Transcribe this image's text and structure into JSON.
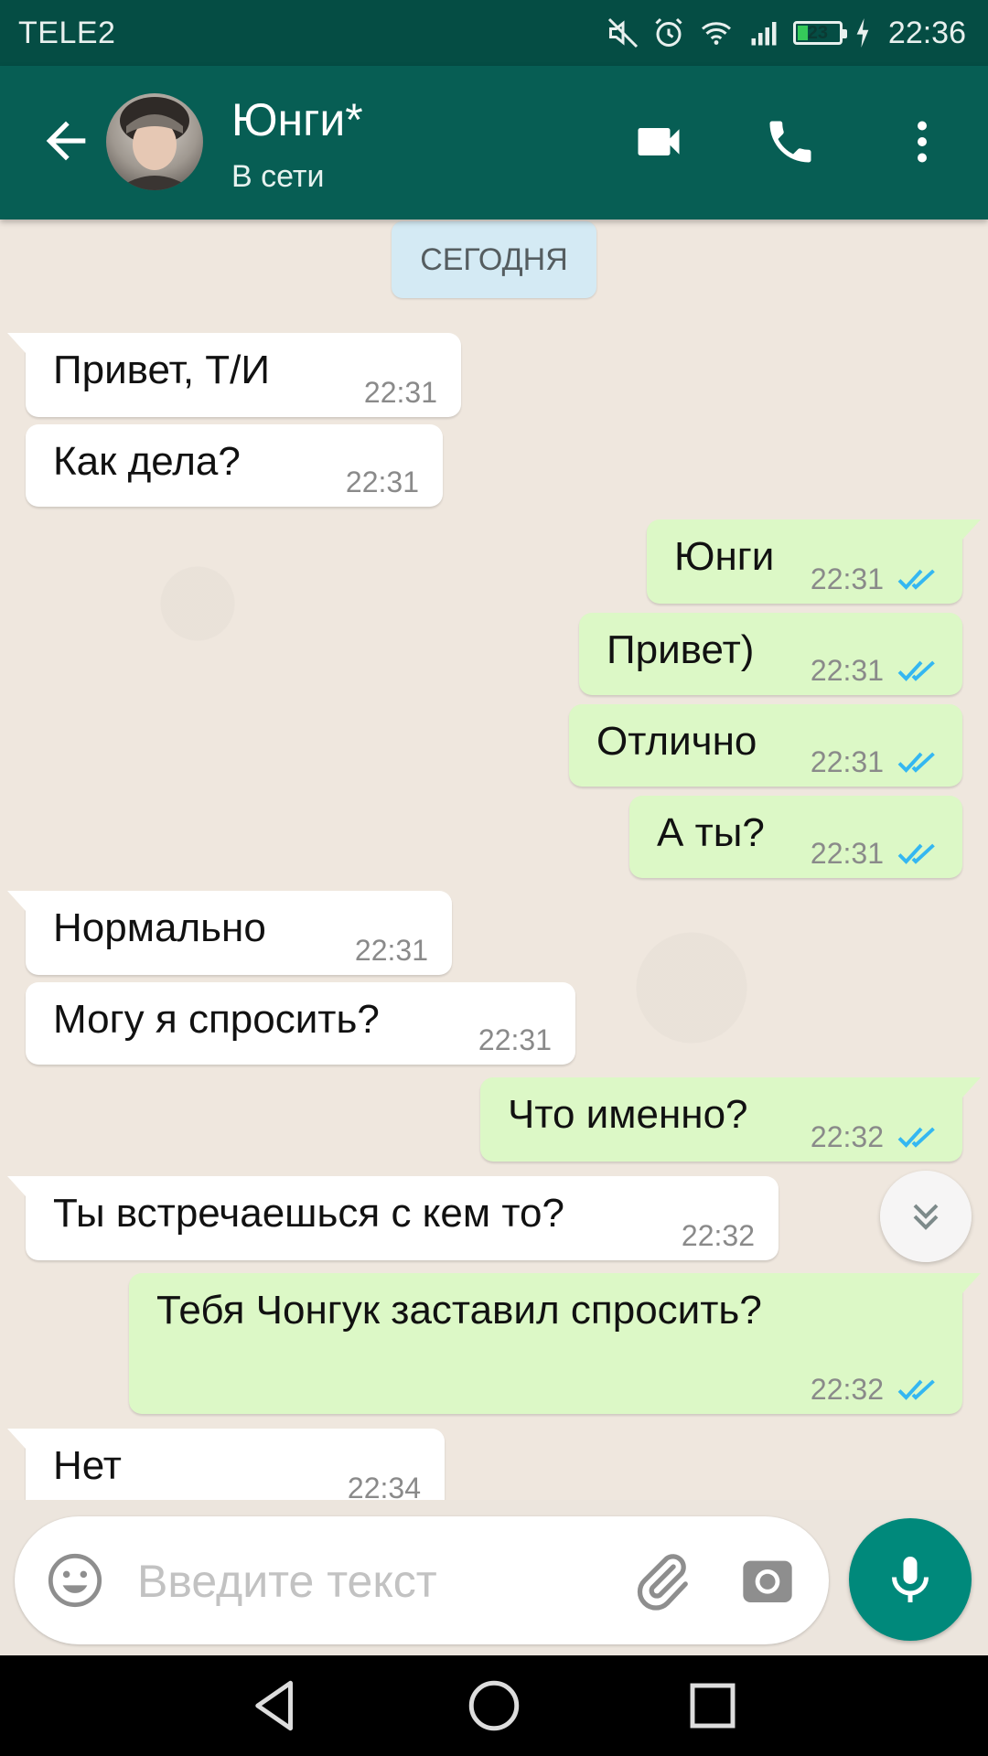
{
  "status_bar": {
    "carrier": "TELE2",
    "battery": "23",
    "battery_level": 0.23,
    "time": "22:36"
  },
  "header": {
    "contact_name": "Юнги*",
    "contact_status": "В сети"
  },
  "chat": {
    "date_label": "СЕГОДНЯ",
    "messages": [
      {
        "dir": "in",
        "text": "Привет, Т/И",
        "time": "22:31"
      },
      {
        "dir": "in",
        "text": "Как дела?",
        "time": "22:31"
      },
      {
        "dir": "out",
        "text": "Юнги",
        "time": "22:31",
        "read": true
      },
      {
        "dir": "out",
        "text": "Привет)",
        "time": "22:31",
        "read": true
      },
      {
        "dir": "out",
        "text": "Отлично",
        "time": "22:31",
        "read": true
      },
      {
        "dir": "out",
        "text": "А ты?",
        "time": "22:31",
        "read": true
      },
      {
        "dir": "in",
        "text": "Нормально",
        "time": "22:31"
      },
      {
        "dir": "in",
        "text": "Могу я спросить?",
        "time": "22:31"
      },
      {
        "dir": "out",
        "text": "Что именно?",
        "time": "22:32",
        "read": true
      },
      {
        "dir": "in",
        "text": "Ты встречаешься с кем то?",
        "time": "22:32"
      },
      {
        "dir": "out",
        "text": "Тебя Чонгук заставил спросить?",
        "time": "22:32",
        "read": true
      },
      {
        "dir": "in",
        "text": "Нет",
        "time": "22:34"
      }
    ]
  },
  "composer": {
    "placeholder": "Введите текст",
    "value": ""
  },
  "colors": {
    "header": "#075e54",
    "status_bar": "#054d44",
    "outgoing_bubble": "#dcf8c6",
    "incoming_bubble": "#ffffff",
    "read_ticks": "#34b7f1",
    "mic_button": "#00897b"
  },
  "icons": [
    "back-arrow-icon",
    "video-call-icon",
    "phone-icon",
    "more-vert-icon",
    "double-check-icon",
    "chevron-double-down-icon",
    "emoji-icon",
    "attach-icon",
    "camera-icon",
    "mic-icon",
    "nav-back-icon",
    "nav-home-icon",
    "nav-recents-icon"
  ]
}
